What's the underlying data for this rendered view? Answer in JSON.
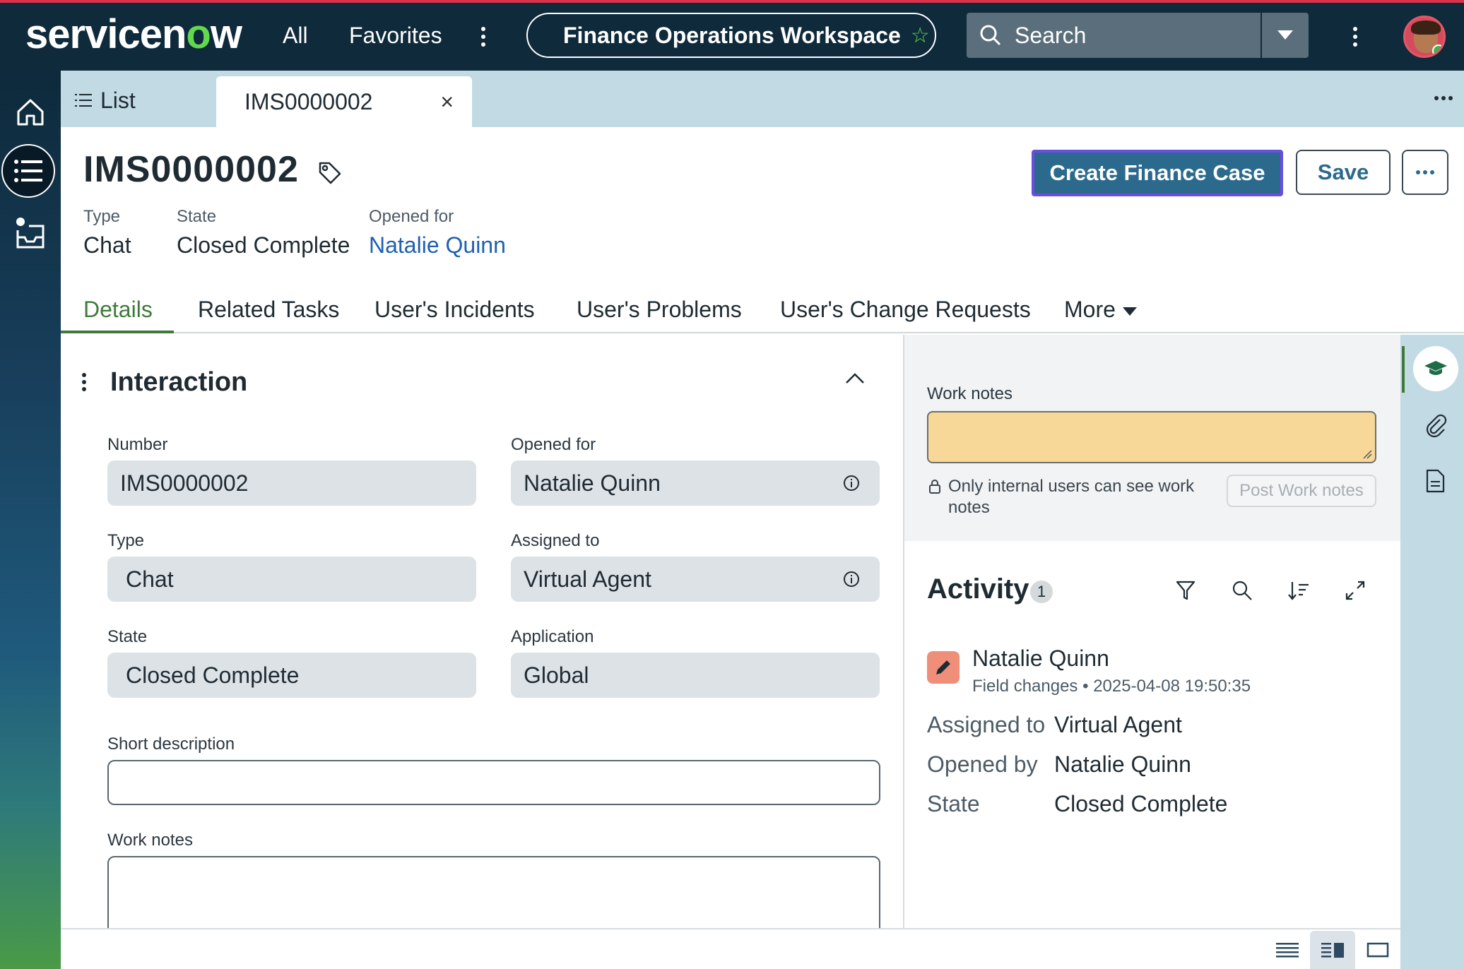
{
  "topbar": {
    "logo_left": "servicen",
    "logo_o": "o",
    "logo_right": "w",
    "all": "All",
    "favorites": "Favorites",
    "workspace": "Finance Operations Workspace",
    "search_placeholder": "Search"
  },
  "tabs": {
    "list": "List",
    "record": "IMS0000002"
  },
  "record": {
    "number": "IMS0000002",
    "meta": [
      {
        "label": "Type",
        "value": "Chat"
      },
      {
        "label": "State",
        "value": "Closed Complete"
      },
      {
        "label": "Opened for",
        "value": "Natalie Quinn"
      }
    ],
    "primary_action": "Create Finance Case",
    "save": "Save"
  },
  "form_tabs": [
    "Details",
    "Related Tasks",
    "User's Incidents",
    "User's Problems",
    "User's Change Requests",
    "More"
  ],
  "section": {
    "title": "Interaction",
    "fields": {
      "number": {
        "label": "Number",
        "value": "IMS0000002"
      },
      "opened_for": {
        "label": "Opened for",
        "value": "Natalie Quinn"
      },
      "type": {
        "label": "Type",
        "value": "Chat"
      },
      "assigned_to": {
        "label": "Assigned to",
        "value": "Virtual Agent"
      },
      "state": {
        "label": "State",
        "value": "Closed Complete"
      },
      "application": {
        "label": "Application",
        "value": "Global"
      },
      "short_description": {
        "label": "Short description",
        "value": ""
      },
      "work_notes": {
        "label": "Work notes",
        "value": ""
      }
    }
  },
  "notes": {
    "label": "Work notes",
    "value": "",
    "visibility_note": "Only internal users can see work notes",
    "post_button": "Post Work notes"
  },
  "activity": {
    "title": "Activity",
    "count": "1",
    "entry": {
      "author": "Natalie Quinn",
      "kind": "Field changes",
      "timestamp": "2025-04-08 19:50:35",
      "changes": [
        {
          "field": "Assigned to",
          "value": "Virtual Agent"
        },
        {
          "field": "Opened by",
          "value": "Natalie Quinn"
        },
        {
          "field": "State",
          "value": "Closed Complete"
        }
      ]
    }
  },
  "colors": {
    "topbar": "#0e2a3b",
    "accent_green": "#62d84e",
    "primary_button": "#2c6a8d",
    "link": "#2060b0",
    "work_notes_bg": "#f8d899",
    "tab_active": "#3f7a3b"
  },
  "icons": {
    "rail": [
      "home-icon",
      "list-icon",
      "inbox-icon"
    ],
    "side_rail": [
      "graduation-cap-icon",
      "paperclip-icon",
      "document-icon"
    ],
    "activity_tools": [
      "filter-icon",
      "search-icon",
      "sort-icon",
      "expand-icon"
    ],
    "views": [
      "compact-list-icon",
      "split-view-icon",
      "single-view-icon"
    ]
  }
}
